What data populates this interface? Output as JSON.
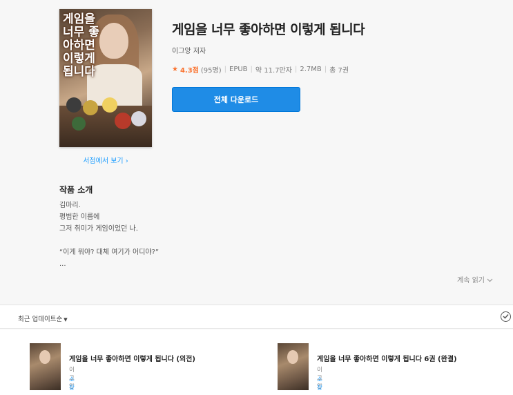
{
  "book": {
    "title": "게임을 너무 좋아하면 이렇게 됩니다",
    "author": "이그앙 저자",
    "rating": "4.3점",
    "rating_count": "(95명)",
    "format": "EPUB",
    "length": "약 11.7만자",
    "size": "2.7MB",
    "volumes": "총 7권",
    "cover_text": "게임을 너무 좋아하면 이렇게 됩니다"
  },
  "actions": {
    "download_label": "전체 다운로드",
    "store_link": "서점에서 보기 ›",
    "more_label": "계속 읽기"
  },
  "intro": {
    "heading": "작품 소개",
    "lines": [
      "김마리.",
      "평범한 이름에",
      "그저 취미가 게임이었던 나.",
      "",
      "“이게 뭐야? 대체 여기가 어디야?”",
      "..."
    ]
  },
  "sort": {
    "label": "최근 업데이트순"
  },
  "items": [
    {
      "name": "게임을 너무 좋아하면 이렇게 됩니다 (외전)",
      "author": "이그앙",
      "status": "소장"
    },
    {
      "name": "게임을 너무 좋아하면 이렇게 됩니다 6권 (완결)",
      "author": "이그앙",
      "status": "소장"
    }
  ],
  "colors": {
    "accent": "#1f8ce6",
    "rating": "#fa722e",
    "link": "#1e9eff"
  }
}
